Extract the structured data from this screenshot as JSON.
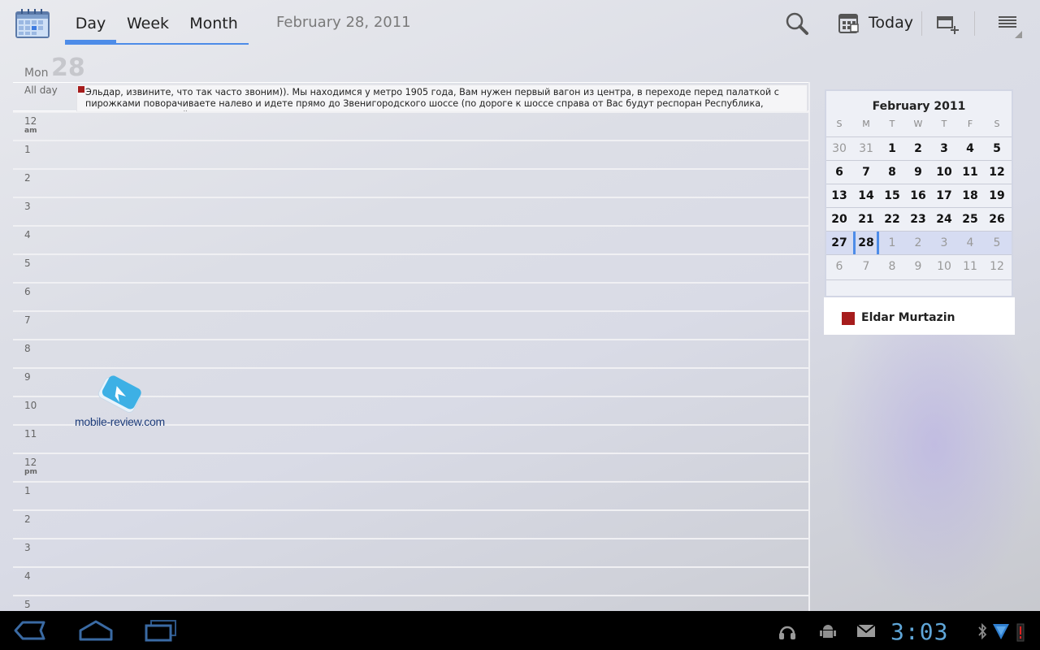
{
  "tabs": [
    {
      "label": "Day"
    },
    {
      "label": "Week"
    },
    {
      "label": "Month"
    }
  ],
  "header": {
    "date_title": "February 28, 2011",
    "today_label": "Today"
  },
  "day": {
    "name": "Mon",
    "number": "28",
    "allday_label": "All day",
    "event_text": "Эльдар, извините, что так часто звоним)). Мы находимся у метро 1905 года, Вам нужен первый вагон из центра, в переходе перед палаткой с пирожками поворачиваете налево и идете прямо до Звенигородского шоссе (по дороге к шоссе справа от Вас будут респоран Республика, аптека, продуктовый",
    "event_color": "#a61c1c",
    "hours": [
      {
        "h": "12",
        "ampm": "am"
      },
      {
        "h": "1",
        "ampm": ""
      },
      {
        "h": "2",
        "ampm": ""
      },
      {
        "h": "3",
        "ampm": ""
      },
      {
        "h": "4",
        "ampm": ""
      },
      {
        "h": "5",
        "ampm": ""
      },
      {
        "h": "6",
        "ampm": ""
      },
      {
        "h": "7",
        "ampm": ""
      },
      {
        "h": "8",
        "ampm": ""
      },
      {
        "h": "9",
        "ampm": ""
      },
      {
        "h": "10",
        "ampm": ""
      },
      {
        "h": "11",
        "ampm": ""
      },
      {
        "h": "12",
        "ampm": "pm"
      },
      {
        "h": "1",
        "ampm": ""
      },
      {
        "h": "2",
        "ampm": ""
      },
      {
        "h": "3",
        "ampm": ""
      },
      {
        "h": "4",
        "ampm": ""
      },
      {
        "h": "5",
        "ampm": ""
      }
    ]
  },
  "watermark": {
    "text": "mobile-review.com"
  },
  "minical": {
    "title": "February 2011",
    "dow": [
      "S",
      "M",
      "T",
      "W",
      "T",
      "F",
      "S"
    ],
    "weeks": [
      [
        {
          "d": "30",
          "dim": true
        },
        {
          "d": "31",
          "dim": true
        },
        {
          "d": "1"
        },
        {
          "d": "2"
        },
        {
          "d": "3"
        },
        {
          "d": "4"
        },
        {
          "d": "5"
        }
      ],
      [
        {
          "d": "6"
        },
        {
          "d": "7"
        },
        {
          "d": "8"
        },
        {
          "d": "9"
        },
        {
          "d": "10"
        },
        {
          "d": "11"
        },
        {
          "d": "12"
        }
      ],
      [
        {
          "d": "13"
        },
        {
          "d": "14"
        },
        {
          "d": "15"
        },
        {
          "d": "16"
        },
        {
          "d": "17"
        },
        {
          "d": "18"
        },
        {
          "d": "19"
        }
      ],
      [
        {
          "d": "20"
        },
        {
          "d": "21"
        },
        {
          "d": "22"
        },
        {
          "d": "23"
        },
        {
          "d": "24"
        },
        {
          "d": "25"
        },
        {
          "d": "26"
        }
      ],
      [
        {
          "d": "27"
        },
        {
          "d": "28",
          "selected": true
        },
        {
          "d": "1",
          "dim": true
        },
        {
          "d": "2",
          "dim": true
        },
        {
          "d": "3",
          "dim": true
        },
        {
          "d": "4",
          "dim": true
        },
        {
          "d": "5",
          "dim": true
        }
      ],
      [
        {
          "d": "6",
          "dim": true
        },
        {
          "d": "7",
          "dim": true
        },
        {
          "d": "8",
          "dim": true
        },
        {
          "d": "9",
          "dim": true
        },
        {
          "d": "10",
          "dim": true
        },
        {
          "d": "11",
          "dim": true
        },
        {
          "d": "12",
          "dim": true
        }
      ]
    ],
    "current_week_index": 4
  },
  "calendars": [
    {
      "name": "Eldar Murtazin",
      "color": "#a61c1c"
    }
  ],
  "status": {
    "clock": "3:03"
  },
  "icons": {
    "app": "calendar-app-icon",
    "search": "search-icon",
    "today": "calendar-grid-icon",
    "new_event": "new-event-icon",
    "menu": "menu-icon",
    "back": "back-icon",
    "home": "home-icon",
    "recents": "recent-apps-icon",
    "headphones": "headphones-icon",
    "android": "android-debug-icon",
    "mail": "mail-icon",
    "bluetooth": "bluetooth-icon",
    "wifi": "wifi-icon",
    "battery": "battery-icon"
  }
}
